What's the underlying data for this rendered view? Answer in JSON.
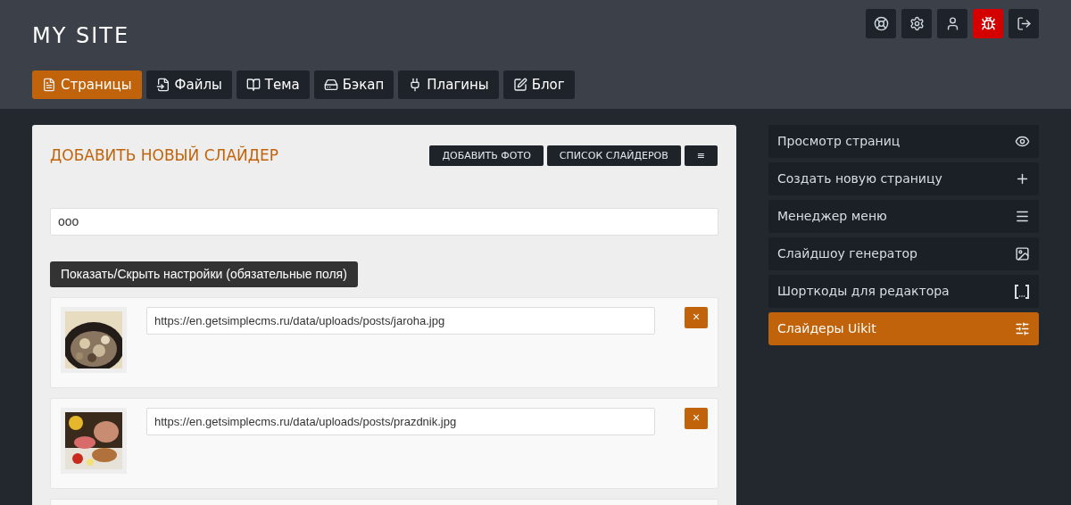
{
  "site_title": "MY SITE",
  "top_buttons": [
    {
      "alert": false
    },
    {
      "alert": false
    },
    {
      "alert": false
    },
    {
      "alert": true
    },
    {
      "alert": false
    }
  ],
  "tabs": [
    {
      "label": "Страницы",
      "selected": true
    },
    {
      "label": "Файлы",
      "selected": false
    },
    {
      "label": "Тема",
      "selected": false
    },
    {
      "label": "Бэкап",
      "selected": false
    },
    {
      "label": "Плагины",
      "selected": false
    },
    {
      "label": "Блог",
      "selected": false
    }
  ],
  "panel": {
    "title": "ДОБАВИТЬ НОВЫЙ СЛАЙДЕР",
    "actions": [
      "ДОБАВИТЬ ФОТО",
      "СПИСОК СЛАЙДЕРОВ",
      "≡"
    ],
    "name_value": "ooo",
    "toggle_label": "Показать/Скрыть настройки (обязательные поля)",
    "slides": [
      {
        "url": "https://en.getsimplecms.ru/data/uploads/posts/jaroha.jpg",
        "remove": "×"
      },
      {
        "url": "https://en.getsimplecms.ru/data/uploads/posts/prazdnik.jpg",
        "remove": "×"
      }
    ]
  },
  "sidebar": [
    {
      "label": "Просмотр страниц",
      "selected": false
    },
    {
      "label": "Создать новую страницу",
      "selected": false
    },
    {
      "label": "Менеджер меню",
      "selected": false
    },
    {
      "label": "Слайдшоу генератор",
      "selected": false
    },
    {
      "label": "Шорткоды для редактора",
      "selected": false
    },
    {
      "label": "Слайдеры Uikit",
      "selected": true
    }
  ]
}
